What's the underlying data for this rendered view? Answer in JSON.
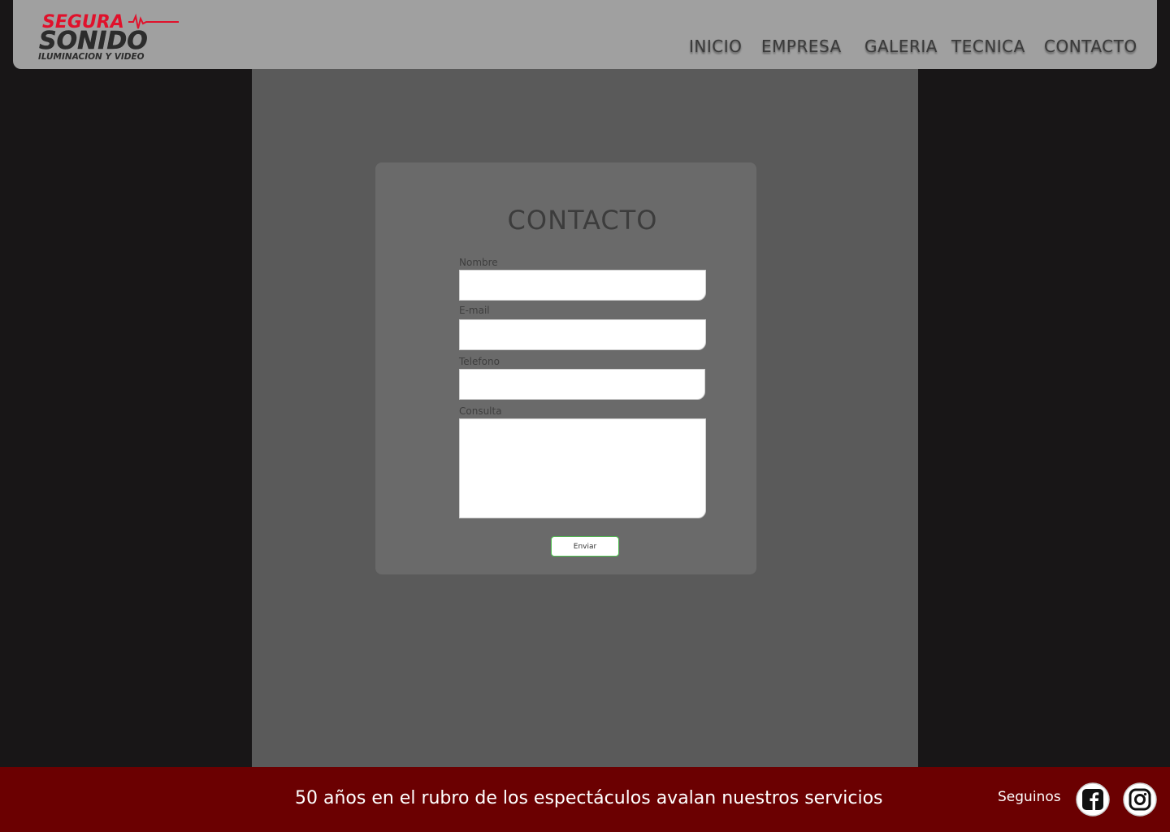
{
  "header": {
    "logo": {
      "line1": "SEGURA",
      "line2": "SONIDO",
      "line3": "ILUMINACION Y VIDEO"
    },
    "nav": [
      "INICIO",
      "EMPRESA",
      "GALERIA",
      "TECNICA",
      "CONTACTO"
    ]
  },
  "form": {
    "title": "CONTACTO",
    "fields": {
      "nombre": {
        "label": "Nombre",
        "value": ""
      },
      "email": {
        "label": "E-mail",
        "value": ""
      },
      "telefono": {
        "label": "Telefono",
        "value": ""
      },
      "consulta": {
        "label": "Consulta",
        "value": ""
      }
    },
    "submit_label": "Enviar"
  },
  "footer": {
    "tagline": "50 años en el rubro de los espectáculos avalan nuestros servicios",
    "follow_label": "Seguinos",
    "social": [
      {
        "icon": "facebook-icon"
      },
      {
        "icon": "instagram-icon"
      }
    ]
  },
  "colors": {
    "header_bg": "#a0a0a0",
    "page_bg": "#181617",
    "panel_bg": "#5a5a5a",
    "card_bg": "#6a6a6a",
    "footer_bg": "#6b0001",
    "logo_red": "#e0112b",
    "submit_border": "#4fbf4f"
  }
}
